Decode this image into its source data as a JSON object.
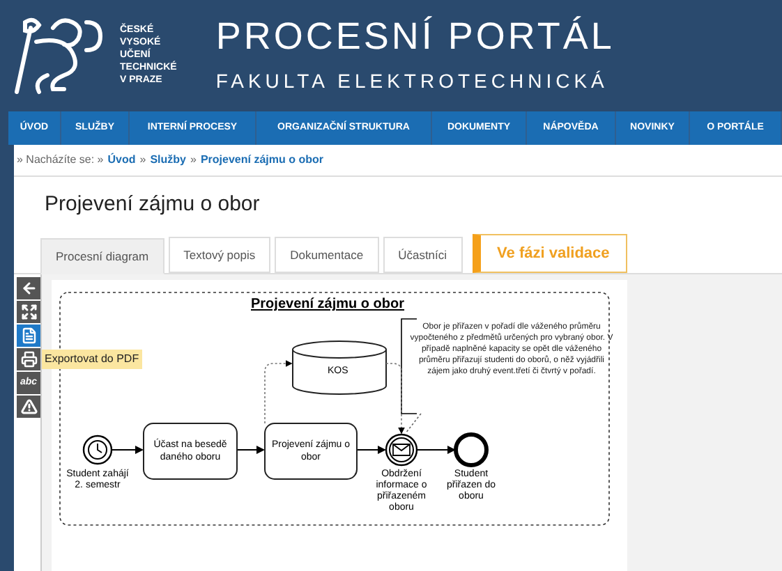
{
  "header": {
    "logo_lines": [
      "ČESKÉ",
      "VYSOKÉ",
      "UČENÍ",
      "TECHNICKÉ",
      "V PRAZE"
    ],
    "title": "PROCESNÍ PORTÁL",
    "subtitle": "FAKULTA ELEKTROTECHNICKÁ"
  },
  "nav": [
    "ÚVOD",
    "SLUŽBY",
    "INTERNÍ PROCESY",
    "ORGANIZAČNÍ STRUKTURA",
    "DOKUMENTY",
    "NÁPOVĚDA",
    "NOVINKY",
    "O PORTÁLE"
  ],
  "breadcrumb": {
    "prefix": "» Nacházíte se: »",
    "links": [
      "Úvod",
      "Služby",
      "Projevení zájmu o obor"
    ],
    "separator": "»"
  },
  "page_title": "Projevení zájmu o obor",
  "tabs": [
    {
      "label": "Procesní diagram",
      "selected": true
    },
    {
      "label": "Textový popis",
      "selected": false
    },
    {
      "label": "Dokumentace",
      "selected": false
    },
    {
      "label": "Účastníci",
      "selected": false
    }
  ],
  "status_badge": "Ve fázi validace",
  "toolbar": [
    {
      "kind": "back",
      "highlighted": false
    },
    {
      "kind": "fullscreen",
      "highlighted": false
    },
    {
      "kind": "pdf",
      "highlighted": true
    },
    {
      "kind": "print",
      "highlighted": false
    },
    {
      "kind": "text",
      "label": "abc",
      "highlighted": false
    },
    {
      "kind": "warning",
      "highlighted": false
    }
  ],
  "tooltip": "Exportovat do PDF",
  "diagram": {
    "title": "Projevení zájmu o obor",
    "data_store": "KOS",
    "annotation": "Obor je přiřazen v pořadí dle váženého průměru vypočteného z předmětů určených pro vybraný obor. V případě naplněné kapacity se opět dle váženého průměru přiřazují studenti do oborů, o něž vyjádřili zájem jako druhý event.třetí či čtvrtý v pořadí.",
    "nodes": [
      {
        "kind": "start",
        "label": "Student zahájí 2. semestr"
      },
      {
        "kind": "task",
        "label": "Účast na besedě daného oboru"
      },
      {
        "kind": "task",
        "label": "Projevení zájmu o obor"
      },
      {
        "kind": "message",
        "label": "Obdržení informace o přiřazeném oboru"
      },
      {
        "kind": "end",
        "label": "Student přiřazen do oboru"
      }
    ]
  }
}
